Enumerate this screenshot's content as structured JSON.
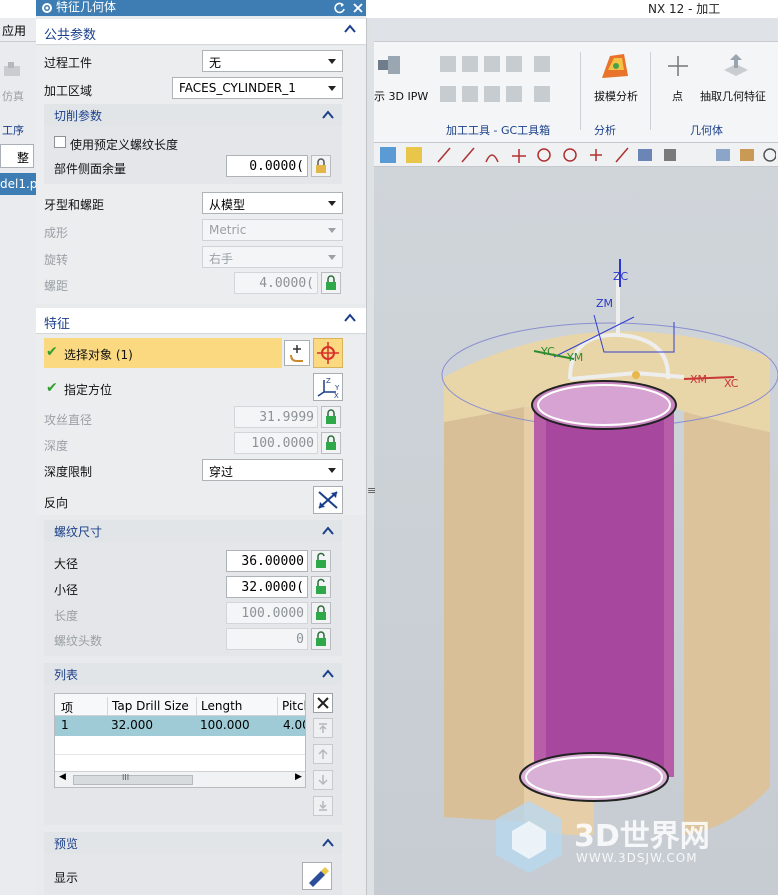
{
  "window": {
    "app_title": "NX 12 - 加工",
    "app_menu_label": "应用",
    "left_strip": {
      "item1": "仿真",
      "item2": "工序",
      "input_value": "整",
      "file_tab": "del1.p"
    }
  },
  "ribbon": {
    "groups": [
      {
        "label": "加工工具 - GC工具箱"
      },
      {
        "label": "分析"
      },
      {
        "label": "几何体"
      }
    ],
    "captions": {
      "ipw": "示 3D IPW",
      "draft_analysis": "拔模分析",
      "point": "点",
      "extract_geometry": "抽取几何特征"
    }
  },
  "dialog": {
    "title": "特征几何体",
    "common_params": {
      "header": "公共参数",
      "in_process_workpiece_label": "过程工件",
      "in_process_workpiece_value": "无",
      "machining_area_label": "加工区域",
      "machining_area_value": "FACES_CYLINDER_1",
      "cut_params": {
        "header": "切削参数",
        "use_predefined_label": "使用预定义螺纹长度",
        "side_stock_label": "部件侧面余量",
        "side_stock_value": "0.0000("
      },
      "thread_type_label": "牙型和螺距",
      "thread_type_value": "从模型",
      "form_label": "成形",
      "form_value": "Metric",
      "rotation_label": "旋转",
      "rotation_value": "右手",
      "pitch_label": "螺距",
      "pitch_value": "4.0000("
    },
    "feature": {
      "header": "特征",
      "select_object_label": "选择对象 (1)",
      "orientation_label": "指定方位",
      "tap_diameter_label": "攻丝直径",
      "tap_diameter_value": "31.9999",
      "depth_label": "深度",
      "depth_value": "100.0000",
      "depth_limit_label": "深度限制",
      "depth_limit_value": "穿过",
      "reverse_label": "反向"
    },
    "thread_size": {
      "header": "螺纹尺寸",
      "major_label": "大径",
      "major_value": "36.00000",
      "minor_label": "小径",
      "minor_value": "32.0000(",
      "length_label": "长度",
      "length_value": "100.0000",
      "starts_label": "螺纹头数",
      "starts_value": "0"
    },
    "list": {
      "header": "列表",
      "columns": [
        "项",
        "Tap Drill Size",
        "Length",
        "Pitch"
      ],
      "rows": [
        [
          "1",
          "32.000",
          "100.000",
          "4.00"
        ]
      ],
      "hscroll_marker": "III"
    },
    "preview": {
      "header": "预览",
      "show_label": "显示"
    }
  },
  "viewport": {
    "axis_labels": {
      "zc": "ZC",
      "zm": "ZM",
      "yc": "YC",
      "ym": "YM",
      "xm": "XM",
      "xc": "XC"
    },
    "watermark_main": "3D世界网",
    "watermark_sub": "WWW.3DSJW.COM"
  },
  "colors": {
    "title_blue": "#3d7db4",
    "section_blue": "#1a3f8a",
    "selection_yellow": "#fbd981",
    "check_green": "#2ea02e",
    "cylinder_tan": "#e8cfa6",
    "hole_magenta": "#a8479e"
  }
}
